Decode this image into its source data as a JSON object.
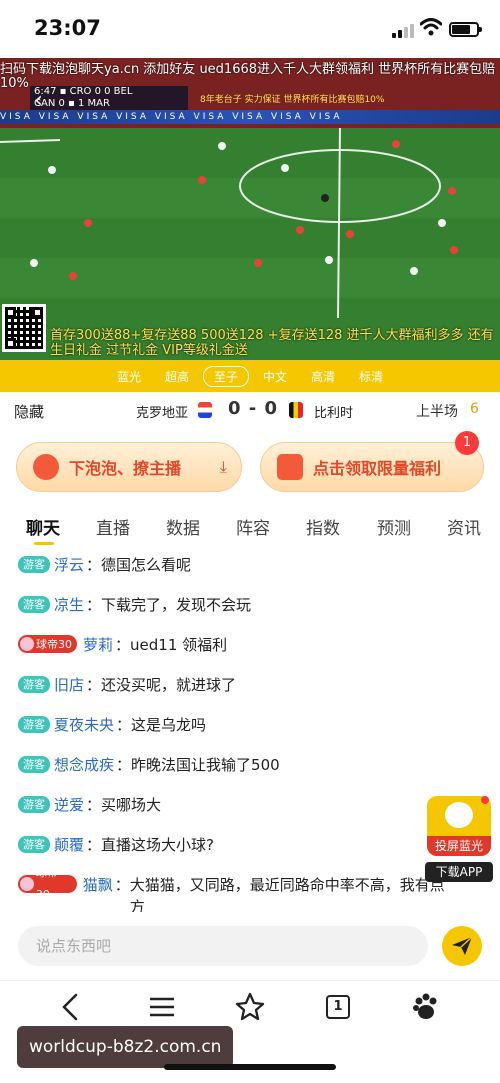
{
  "status_bar": {
    "time": "23:07"
  },
  "video": {
    "ticker_line1": "扫码下载泡泡聊天ya.cn 添加好友 ued1668进入千人大群领福利 世界杯所有比赛包赔",
    "ticker_line2": "10%",
    "score_rows": [
      "6:47 ▪ CRO 0 0 BEL",
      "CAN 0 ▪ 1 MAR"
    ],
    "overlay_line1": "8年老台子 实力保证 世界杯所有比赛包赔10%",
    "sponsor_text": "VISA  VISA  VISA  VISA  VISA  VISA  VISA  VISA  VISA",
    "promo_text": "首存300送88+复存送88 500送128 +复存送128 进千人大群福利多多 还有生日礼金 过节礼金 VIP等级礼金送"
  },
  "quality": {
    "options": [
      "蓝光",
      "超高",
      "至子",
      "中文",
      "高清",
      "标清"
    ],
    "active_index": 2
  },
  "match": {
    "hide_label": "隐藏",
    "home_team": "克罗地亚",
    "score": "0 - 0",
    "away_team": "比利时",
    "period": "上半场",
    "period_number": "6"
  },
  "actions": {
    "left_label": "下泡泡、撩主播",
    "right_label": "点击领取限量福利",
    "badge_count": "1"
  },
  "tabs": [
    "聊天",
    "直播",
    "数据",
    "阵容",
    "指数",
    "预测",
    "资讯"
  ],
  "chat": [
    {
      "tag": "游客",
      "nick": "浮云",
      "text": "德国怎么看呢"
    },
    {
      "tag": "游客",
      "nick": "凉生",
      "text": "下载完了，发现不会玩"
    },
    {
      "tag": "球帝30",
      "nick": "萝莉",
      "text": "ued11 领福利"
    },
    {
      "tag": "游客",
      "nick": "旧店",
      "text": "还没买呢，就进球了"
    },
    {
      "tag": "游客",
      "nick": "夏夜未央",
      "text": "这是乌龙吗"
    },
    {
      "tag": "游客",
      "nick": "想念成疾",
      "text": "昨晚法国让我输了500"
    },
    {
      "tag": "游客",
      "nick": "逆爱",
      "text": "买哪场大"
    },
    {
      "tag": "游客",
      "nick": "颠覆",
      "text": "直播这场大小球?"
    },
    {
      "tag": "球帝30",
      "nick": "猫飘",
      "text": "大猫猫，又同路，最近同路命中率不高，我有点方"
    }
  ],
  "floating_app": {
    "label1": "投屏蓝光",
    "label2": "下载APP"
  },
  "input": {
    "placeholder": "说点东西吧"
  },
  "browser": {
    "tab_count": "1"
  },
  "watermark": "worldcup-b8z2.com.cn",
  "colors": {
    "accent": "#f5c700",
    "guest_tag": "#3cc5b8",
    "king_tag": "#e0392b",
    "nick": "#2a6ac8"
  }
}
